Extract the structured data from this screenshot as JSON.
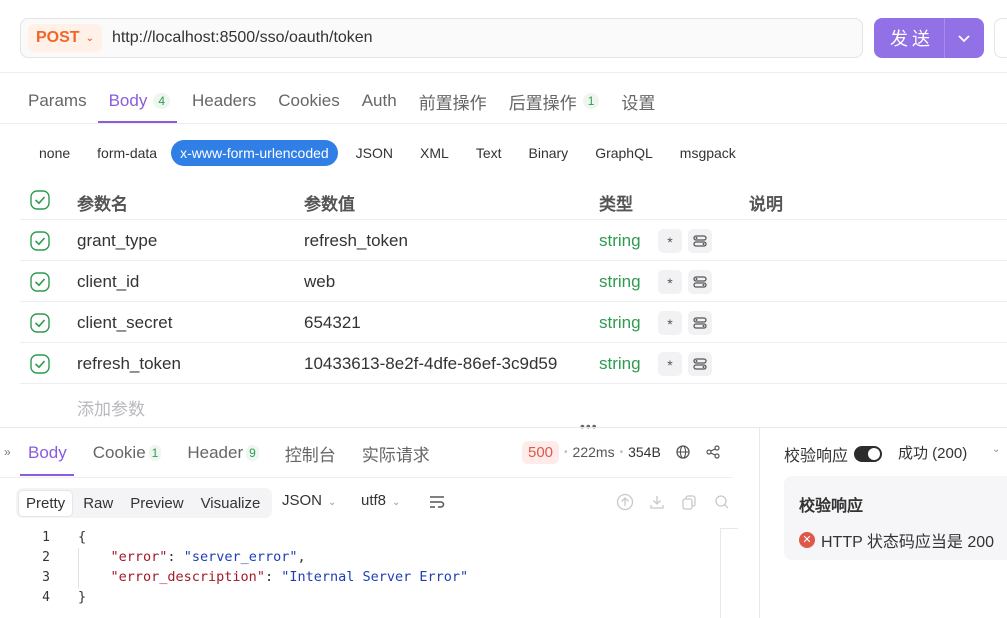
{
  "request": {
    "method": "POST",
    "url": "http://localhost:8500/sso/oauth/token",
    "send_label": "发送"
  },
  "req_tabs": [
    {
      "label": "Params",
      "badge": ""
    },
    {
      "label": "Body",
      "badge": "4"
    },
    {
      "label": "Headers",
      "badge": ""
    },
    {
      "label": "Cookies",
      "badge": ""
    },
    {
      "label": "Auth",
      "badge": ""
    },
    {
      "label": "前置操作",
      "badge": ""
    },
    {
      "label": "后置操作",
      "badge": "1"
    },
    {
      "label": "设置",
      "badge": ""
    }
  ],
  "body_types": [
    "none",
    "form-data",
    "x-www-form-urlencoded",
    "JSON",
    "XML",
    "Text",
    "Binary",
    "GraphQL",
    "msgpack"
  ],
  "params": {
    "headers": {
      "name": "参数名",
      "value": "参数值",
      "type": "类型",
      "desc": "说明"
    },
    "rows": [
      {
        "name": "grant_type",
        "value": "refresh_token",
        "type": "string"
      },
      {
        "name": "client_id",
        "value": "web",
        "type": "string"
      },
      {
        "name": "client_secret",
        "value": "654321",
        "type": "string"
      },
      {
        "name": "refresh_token",
        "value": "10433613-8e2f-4dfe-86ef-3c9d59",
        "type": "string"
      }
    ],
    "required_mark": "*",
    "add_label": "添加参数"
  },
  "response": {
    "tabs": [
      {
        "label": "Body",
        "badge": ""
      },
      {
        "label": "Cookie",
        "badge": "1"
      },
      {
        "label": "Header",
        "badge": "9"
      },
      {
        "label": "控制台",
        "badge": ""
      },
      {
        "label": "实际请求",
        "badge": ""
      }
    ],
    "status_code": "500",
    "time": "222ms",
    "size": "354B",
    "view_modes": [
      "Pretty",
      "Raw",
      "Preview",
      "Visualize"
    ],
    "format": "JSON",
    "encoding": "utf8",
    "line_numbers": [
      "1",
      "2",
      "3",
      "4"
    ],
    "code": {
      "open": "{",
      "k1": "\"error\"",
      "v1": "\"server_error\"",
      "k2": "\"error_description\"",
      "v2": "\"Internal Server Error\"",
      "close": "}"
    }
  },
  "assertions": {
    "title": "校验响应",
    "result": "成功 (200)",
    "card_title": "校验响应",
    "item": "HTTP 状态码应当是 200"
  },
  "colors": {
    "accent": "#8a5ddc",
    "send": "#9270e6",
    "method": "#f0662a",
    "type": "#2f9b4f",
    "error": "#e0584a",
    "selected": "#2f7fe6"
  }
}
